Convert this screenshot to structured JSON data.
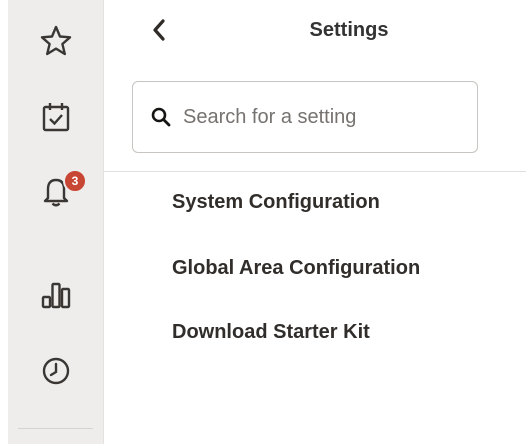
{
  "sidebar": {
    "icons": {
      "favorites": "star-icon",
      "tasks": "calendar-check-icon",
      "notifications": "bell-icon",
      "reports": "bar-chart-icon",
      "recent": "clock-icon"
    },
    "notification_count": "3"
  },
  "panel": {
    "back_icon": "chevron-left-icon",
    "title": "Settings",
    "search": {
      "placeholder": "Search for a setting",
      "value": ""
    },
    "menu": [
      {
        "label": "System Configuration"
      },
      {
        "label": "Global Area Configuration"
      },
      {
        "label": "Download Starter Kit"
      }
    ]
  },
  "colors": {
    "sidebar_bg": "#efedeb",
    "badge": "#c74634",
    "text": "#312d2a"
  }
}
